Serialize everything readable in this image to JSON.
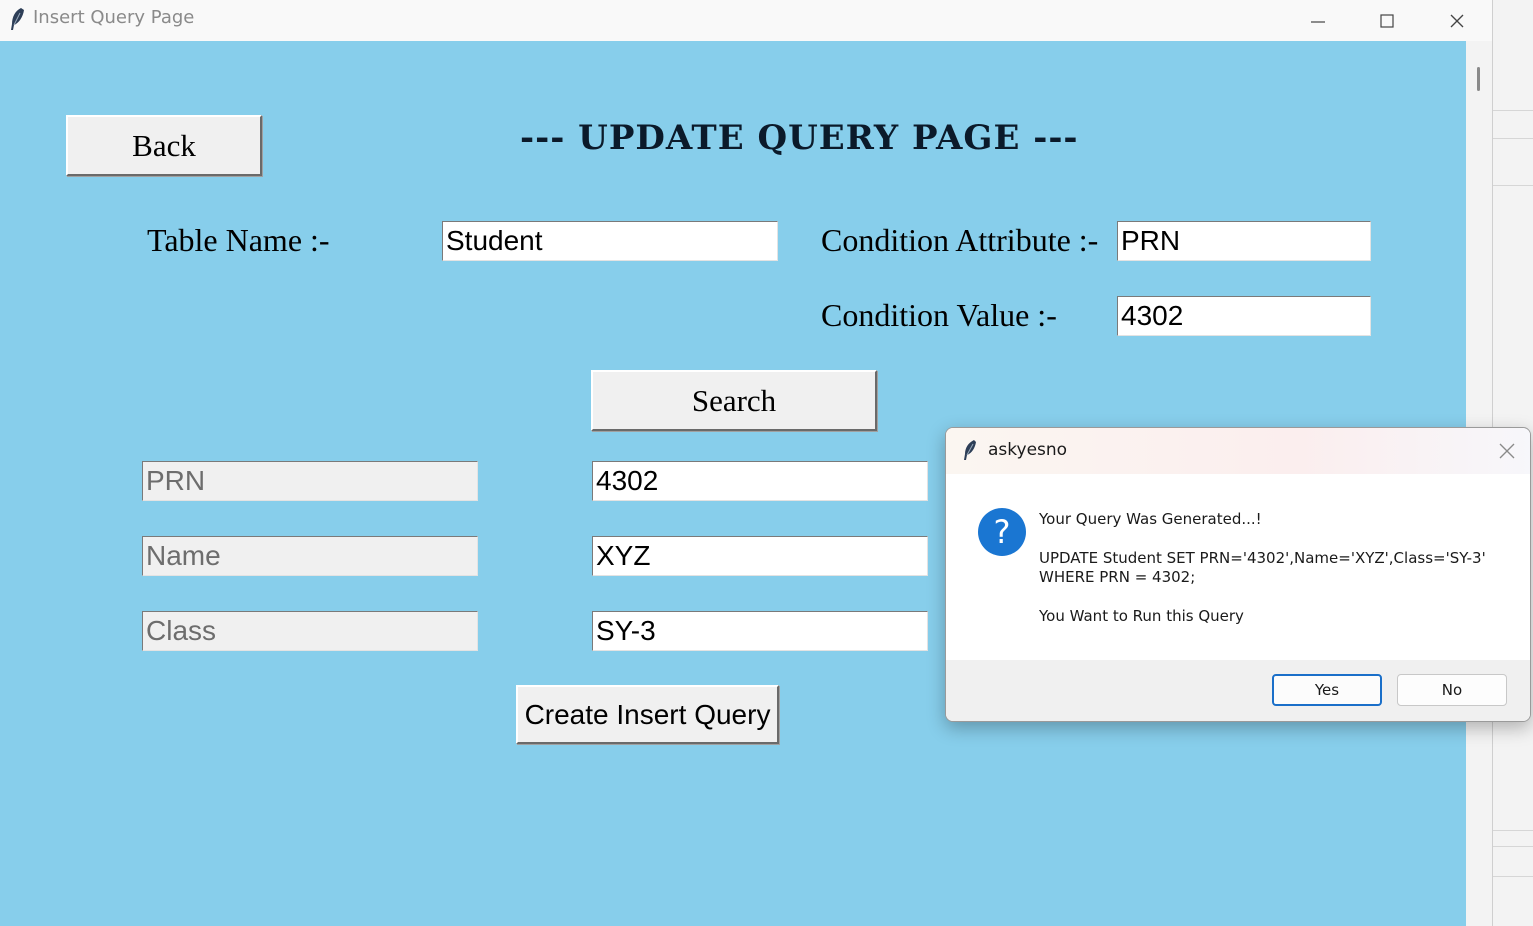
{
  "window": {
    "title": "Insert Query Page"
  },
  "page": {
    "back_label": "Back",
    "heading": "--- UPDATE QUERY PAGE ---",
    "table_name_label": "Table Name :-",
    "table_name_value": "Student",
    "condition_attribute_label": "Condition Attribute :-",
    "condition_attribute_value": "PRN",
    "condition_value_label": "Condition Value :-",
    "condition_value_value": "4302",
    "search_label": "Search",
    "fields": [
      {
        "name": "PRN",
        "value": "4302"
      },
      {
        "name": "Name",
        "value": "XYZ"
      },
      {
        "name": "Class",
        "value": "SY-3"
      }
    ],
    "create_query_label": "Create Insert Query"
  },
  "dialog": {
    "title": "askyesno",
    "icon": "question-icon",
    "message_line1": "Your Query Was Generated...!",
    "message_line2": "UPDATE Student SET PRN='4302',Name='XYZ',Class='SY-3'",
    "message_line3": "WHERE PRN = 4302;",
    "message_line4": "You Want to Run this Query",
    "yes_label": "Yes",
    "no_label": "No"
  },
  "colors": {
    "client_background": "#87ceeb",
    "button_face": "#f0f0f0",
    "dialog_default_border": "#1a6fc9",
    "question_icon": "#1a76d2"
  }
}
